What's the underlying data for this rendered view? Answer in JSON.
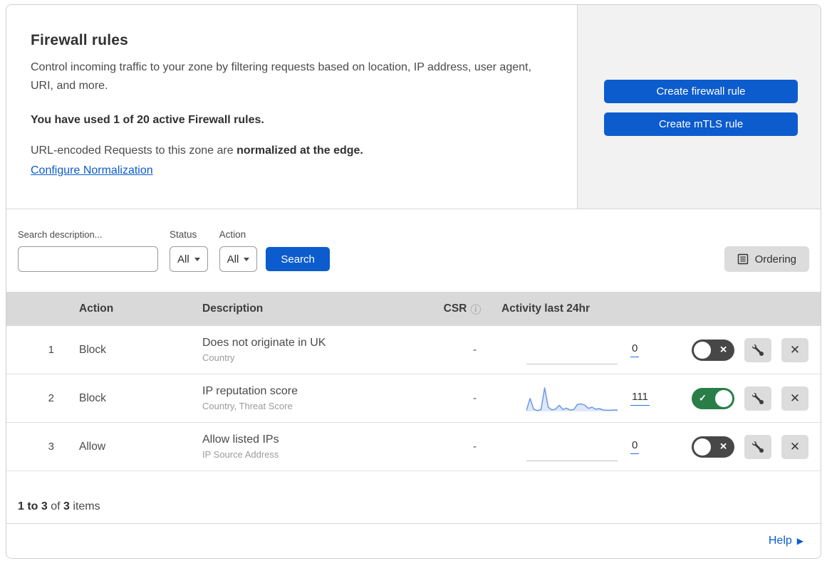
{
  "header": {
    "title": "Firewall rules",
    "description": "Control incoming traffic to your zone by filtering requests based on location, IP address, user agent, URI, and more.",
    "usage": "You have used 1 of 20 active Firewall rules.",
    "normalization_text": "URL-encoded Requests to this zone are ",
    "normalization_bold": "normalized at the edge.",
    "normalization_link": "Configure Normalization",
    "create_firewall_button": "Create firewall rule",
    "create_mtls_button": "Create mTLS rule"
  },
  "filters": {
    "search_label": "Search description...",
    "search_value": "",
    "status_label": "Status",
    "status_value": "All",
    "action_label": "Action",
    "action_value": "All",
    "search_button": "Search",
    "ordering_button": "Ordering"
  },
  "table": {
    "columns": {
      "action": "Action",
      "description": "Description",
      "csr": "CSR",
      "activity": "Activity last 24hr"
    },
    "rows": [
      {
        "priority": "1",
        "action": "Block",
        "description": "Does not originate in UK",
        "fields": "Country",
        "csr": "-",
        "activity_count": "0",
        "enabled": false,
        "sparkline": []
      },
      {
        "priority": "2",
        "action": "Block",
        "description": "IP reputation score",
        "fields": "Country, Threat Score",
        "csr": "-",
        "activity_count": "111",
        "enabled": true,
        "sparkline": [
          4,
          55,
          10,
          3,
          8,
          100,
          18,
          6,
          10,
          26,
          8,
          14,
          6,
          8,
          30,
          32,
          27,
          13,
          18,
          9,
          12,
          6,
          5,
          5,
          6,
          5
        ]
      },
      {
        "priority": "3",
        "action": "Allow",
        "description": "Allow listed IPs",
        "fields": "IP Source Address",
        "csr": "-",
        "activity_count": "0",
        "enabled": false,
        "sparkline": []
      }
    ]
  },
  "footer": {
    "range": "1 to 3",
    "of_text": "of",
    "total": "3",
    "items_text": "items",
    "help_link": "Help"
  },
  "icons": {
    "check": "✓",
    "cross": "✕",
    "close": "✕",
    "info": "ⓘ",
    "help_arrow": "▶"
  },
  "colors": {
    "primary_blue": "#0c5ccd",
    "toggle_on_green": "#287e46",
    "toggle_off_gray": "#474747",
    "spark_line": "#6b99e5",
    "spark_fill": "#dfe8f9",
    "table_header_bg": "#d9d9d9"
  }
}
